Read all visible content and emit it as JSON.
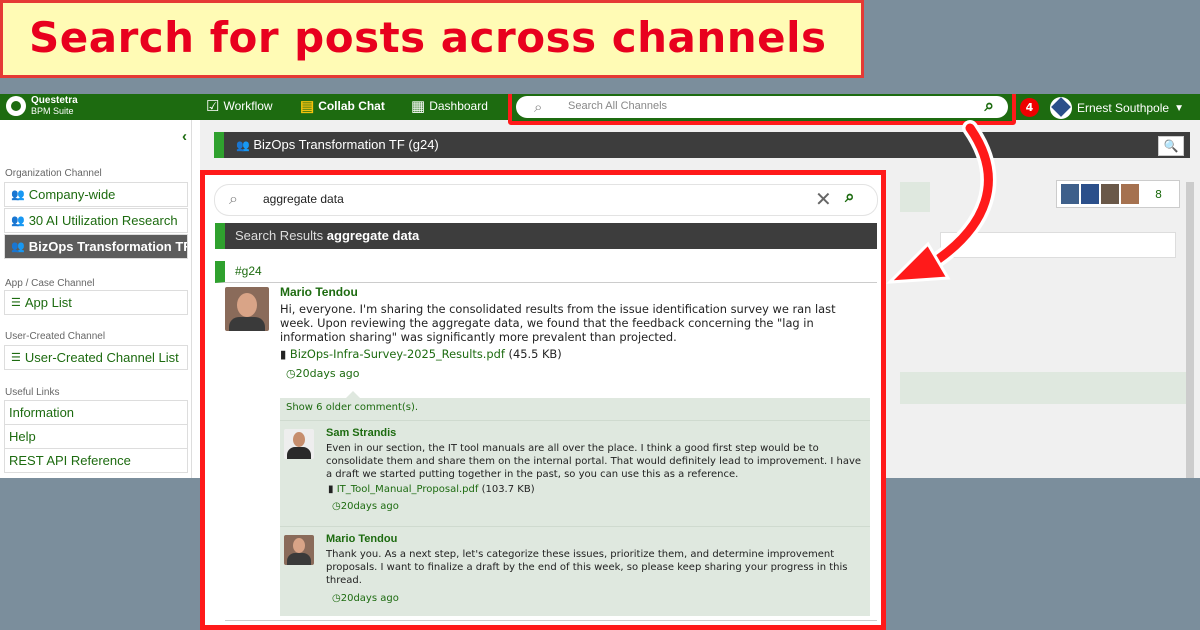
{
  "banner": {
    "title": "Search for posts across channels"
  },
  "topbar": {
    "logo_name": "Questetra",
    "logo_sub": "BPM Suite",
    "nav": {
      "workflow": "Workflow",
      "collab_chat": "Collab Chat",
      "dashboard": "Dashboard"
    },
    "search_placeholder": "Search All Channels",
    "notifications": "4",
    "user_name": "Ernest Southpole"
  },
  "sidebar": {
    "org_title": "Organization Channel",
    "org_items": [
      "Company-wide",
      "30 AI Utilization Research",
      "BizOps Transformation TF"
    ],
    "app_title": "App / Case Channel",
    "app_items": [
      "App List"
    ],
    "user_title": "User-Created Channel",
    "user_items": [
      "User-Created Channel List"
    ],
    "links_title": "Useful Links",
    "links": [
      "Information",
      "Help",
      "REST API Reference"
    ]
  },
  "channel": {
    "title": "BizOps Transformation TF (g24)",
    "member_count": "8"
  },
  "search": {
    "query": "aggregate data",
    "results_prefix": "Search Results",
    "results_query": "aggregate data",
    "tag": "#g24"
  },
  "post": {
    "author": "Mario Tendou",
    "message": "Hi, everyone. I'm sharing the consolidated results from the issue identification survey we ran last week. Upon reviewing the aggregate data, we found that the feedback concerning the \"lag in information sharing\" was significantly more prevalent than projected.",
    "attachment": "BizOps-Infra-Survey-2025_Results.pdf",
    "attachment_size": "(45.5 KB)",
    "time": "20days ago"
  },
  "comments": {
    "older_label": "Show 6 older comment(s).",
    "items": [
      {
        "author": "Sam Strandis",
        "message": "Even in our section, the IT tool manuals are all over the place. I think a good first step would be to consolidate them and share them on the internal portal. That would definitely lead to improvement. I have a draft we started putting together in the past, so you can use this as a reference.",
        "attachment": "IT_Tool_Manual_Proposal.pdf",
        "attachment_size": "(103.7 KB)",
        "time": "20days ago"
      },
      {
        "author": "Mario Tendou",
        "message": "Thank you. As a next step, let's categorize these issues, prioritize them, and determine improvement proposals. I want to finalize a draft by the end of this week, so please keep sharing your progress in this thread.",
        "time": "20days ago"
      }
    ]
  },
  "icons": {
    "search": "search-icon",
    "clear": "clear-icon",
    "collapse": "chevron-left-icon",
    "group": "group-icon",
    "list": "list-icon",
    "clip": "paperclip-icon",
    "clock": "clock-icon"
  },
  "colors": {
    "brand_green": "#1d6b10",
    "accent_red": "#ff1a1a",
    "banner_bg": "#fffbb5",
    "tag_green": "#2fa12e"
  }
}
